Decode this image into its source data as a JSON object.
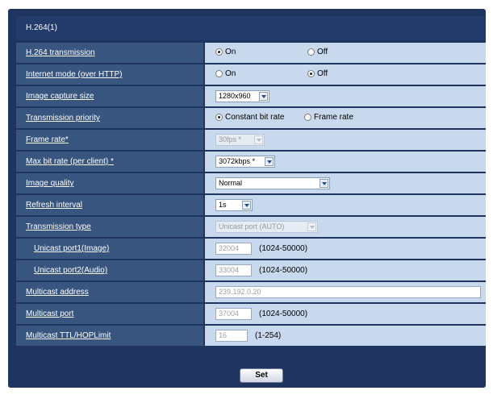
{
  "section": {
    "title": "H.264(1)"
  },
  "rows": {
    "transmission": {
      "label": "H.264 transmission",
      "options": [
        "On",
        "Off"
      ],
      "selected": "On"
    },
    "internet_mode": {
      "label": "Internet mode (over HTTP)",
      "options": [
        "On",
        "Off"
      ],
      "selected": "Off"
    },
    "image_capture_size": {
      "label": "Image capture size",
      "value": "1280x960"
    },
    "transmission_priority": {
      "label": "Transmission priority",
      "options": [
        "Constant bit rate",
        "Frame rate"
      ],
      "selected": "Constant bit rate"
    },
    "frame_rate": {
      "label": "Frame rate*",
      "value": "30fps *"
    },
    "max_bit_rate": {
      "label": "Max bit rate (per client) *",
      "value": "3072kbps *"
    },
    "image_quality": {
      "label": "Image quality",
      "value": "Normal"
    },
    "refresh_interval": {
      "label": "Refresh interval",
      "value": "1s"
    },
    "transmission_type": {
      "label": "Transmission type",
      "value": "Unicast port (AUTO)"
    },
    "unicast_port_image": {
      "label": "Unicast port1(Image)",
      "value": "32004",
      "range": "(1024-50000)"
    },
    "unicast_port_audio": {
      "label": "Unicast port2(Audio)",
      "value": "33004",
      "range": "(1024-50000)"
    },
    "multicast_address": {
      "label": "Multicast address",
      "value": "239.192.0.20"
    },
    "multicast_port": {
      "label": "Multicast port",
      "value": "37004",
      "range": "(1024-50000)"
    },
    "multicast_ttl": {
      "label": "Multicast TTL/HOPLimit",
      "value": "16",
      "range": "(1-254)"
    }
  },
  "buttons": {
    "set": "Set"
  }
}
